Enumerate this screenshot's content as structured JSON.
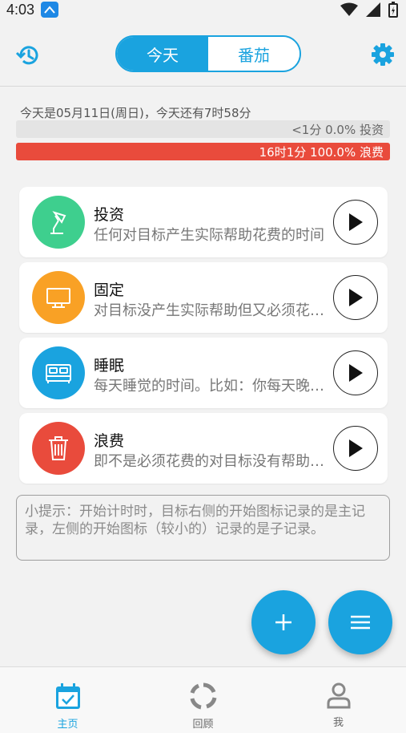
{
  "status_bar": {
    "time": "4:03"
  },
  "header": {
    "tabs": [
      {
        "label": "今天",
        "active": true
      },
      {
        "label": "番茄",
        "active": false
      }
    ]
  },
  "summary": {
    "text": "今天是05月11日(周日)，今天还有7时58分",
    "bars": [
      {
        "label": "<1分 0.0% 投资",
        "color": "#e4e4e4",
        "fraction": 0.0
      },
      {
        "label": "16时1分 100.0% 浪费",
        "color": "#e94b3c",
        "fraction": 1.0
      }
    ]
  },
  "categories": [
    {
      "title": "投资",
      "desc": "任何对目标产生实际帮助花费的时间",
      "color": "#3ecf8e",
      "icon": "desk-lamp-icon"
    },
    {
      "title": "固定",
      "desc": "对目标没产生实际帮助但又必须花费的时间",
      "color": "#f9a125",
      "icon": "monitor-icon"
    },
    {
      "title": "睡眠",
      "desc": "每天睡觉的时间。比如：你每天晚上睡觉",
      "color": "#1aa3df",
      "icon": "bed-icon"
    },
    {
      "title": "浪费",
      "desc": "即不是必须花费的对目标没有帮助的时间",
      "color": "#e94b3c",
      "icon": "trash-icon"
    }
  ],
  "tip": {
    "text": "小提示：开始计时时，目标右侧的开始图标记录的是主记录，左侧的开始图标（较小的）记录的是子记录。"
  },
  "fab": {
    "add_label": "+",
    "accent": "#1aa3df"
  },
  "bottom_nav": {
    "items": [
      {
        "label": "主页",
        "icon": "calendar-check-icon",
        "active": true
      },
      {
        "label": "回顾",
        "icon": "ring-chart-icon",
        "active": false
      },
      {
        "label": "我",
        "icon": "user-icon",
        "active": false
      }
    ]
  }
}
